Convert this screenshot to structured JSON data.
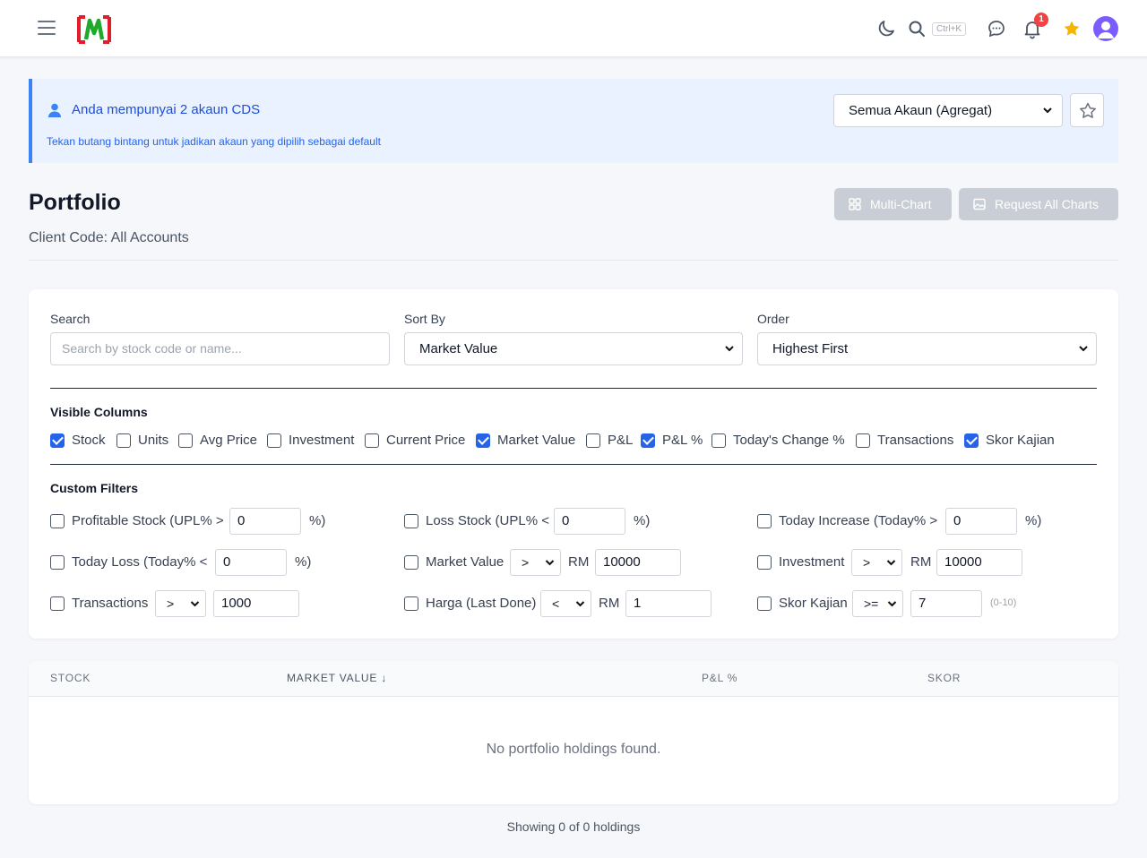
{
  "navbar": {
    "shortcut_hint": "Ctrl+K",
    "notification_count": "1",
    "icons": [
      "menu-icon",
      "moon-icon",
      "search-icon",
      "chat-icon",
      "bell-icon",
      "star-icon",
      "user-avatar-icon"
    ],
    "colors": {
      "star": "#f5b400",
      "avatar": "#7c5cff",
      "badge": "#ef4444"
    }
  },
  "alert": {
    "title": "Anda mempunyai 2 akaun CDS",
    "subtitle": "Tekan butang bintang untuk jadikan akaun yang dipilih sebagai default",
    "account_selected": "Semua Akaun (Agregat)"
  },
  "page": {
    "title": "Portfolio",
    "client_code": "Client Code: All Accounts",
    "multichart_label": "Multi-Chart",
    "request_charts_label": "Request All Charts"
  },
  "filters": {
    "search_label": "Search",
    "search_placeholder": "Search by stock code or name...",
    "sort_label": "Sort By",
    "sort_value": "Market Value",
    "order_label": "Order",
    "order_value": "Highest First"
  },
  "columns": {
    "title": "Visible Columns",
    "items": [
      {
        "label": "Stock",
        "checked": true
      },
      {
        "label": "Units",
        "checked": false
      },
      {
        "label": "Avg Price",
        "checked": false
      },
      {
        "label": "Investment",
        "checked": false
      },
      {
        "label": "Current Price",
        "checked": false
      },
      {
        "label": "Market Value",
        "checked": true
      },
      {
        "label": "P&L",
        "checked": false
      },
      {
        "label": "P&L %",
        "checked": true
      },
      {
        "label": "Today's Change %",
        "checked": false
      },
      {
        "label": "Transactions",
        "checked": false
      },
      {
        "label": "Skor Kajian",
        "checked": true
      }
    ]
  },
  "custom_filters": {
    "title": "Custom Filters",
    "profitable": {
      "label": "Profitable Stock (UPL% >",
      "value": "0",
      "suffix": "%)"
    },
    "loss": {
      "label": "Loss Stock (UPL% <",
      "value": "0",
      "suffix": "%)"
    },
    "today_increase": {
      "label": "Today Increase (Today% >",
      "value": "0",
      "suffix": "%)"
    },
    "today_loss": {
      "label": "Today Loss (Today% <",
      "value": "0",
      "suffix": "%)"
    },
    "market_value": {
      "label": "Market Value",
      "op": ">",
      "currency": "RM",
      "value": "10000"
    },
    "investment": {
      "label": "Investment",
      "op": ">",
      "currency": "RM",
      "value": "10000"
    },
    "transactions": {
      "label": "Transactions",
      "op": ">",
      "value": "1000"
    },
    "harga": {
      "label": "Harga (Last Done)",
      "op": "<",
      "currency": "RM",
      "value": "1"
    },
    "skor": {
      "label": "Skor Kajian",
      "op": ">=",
      "value": "7",
      "hint": "(0-10)"
    }
  },
  "table": {
    "headers": [
      "STOCK",
      "MARKET VALUE ↓",
      "P&L %",
      "SKOR"
    ],
    "empty_message": "No portfolio holdings found.",
    "footer": "Showing 0 of 0 holdings"
  }
}
